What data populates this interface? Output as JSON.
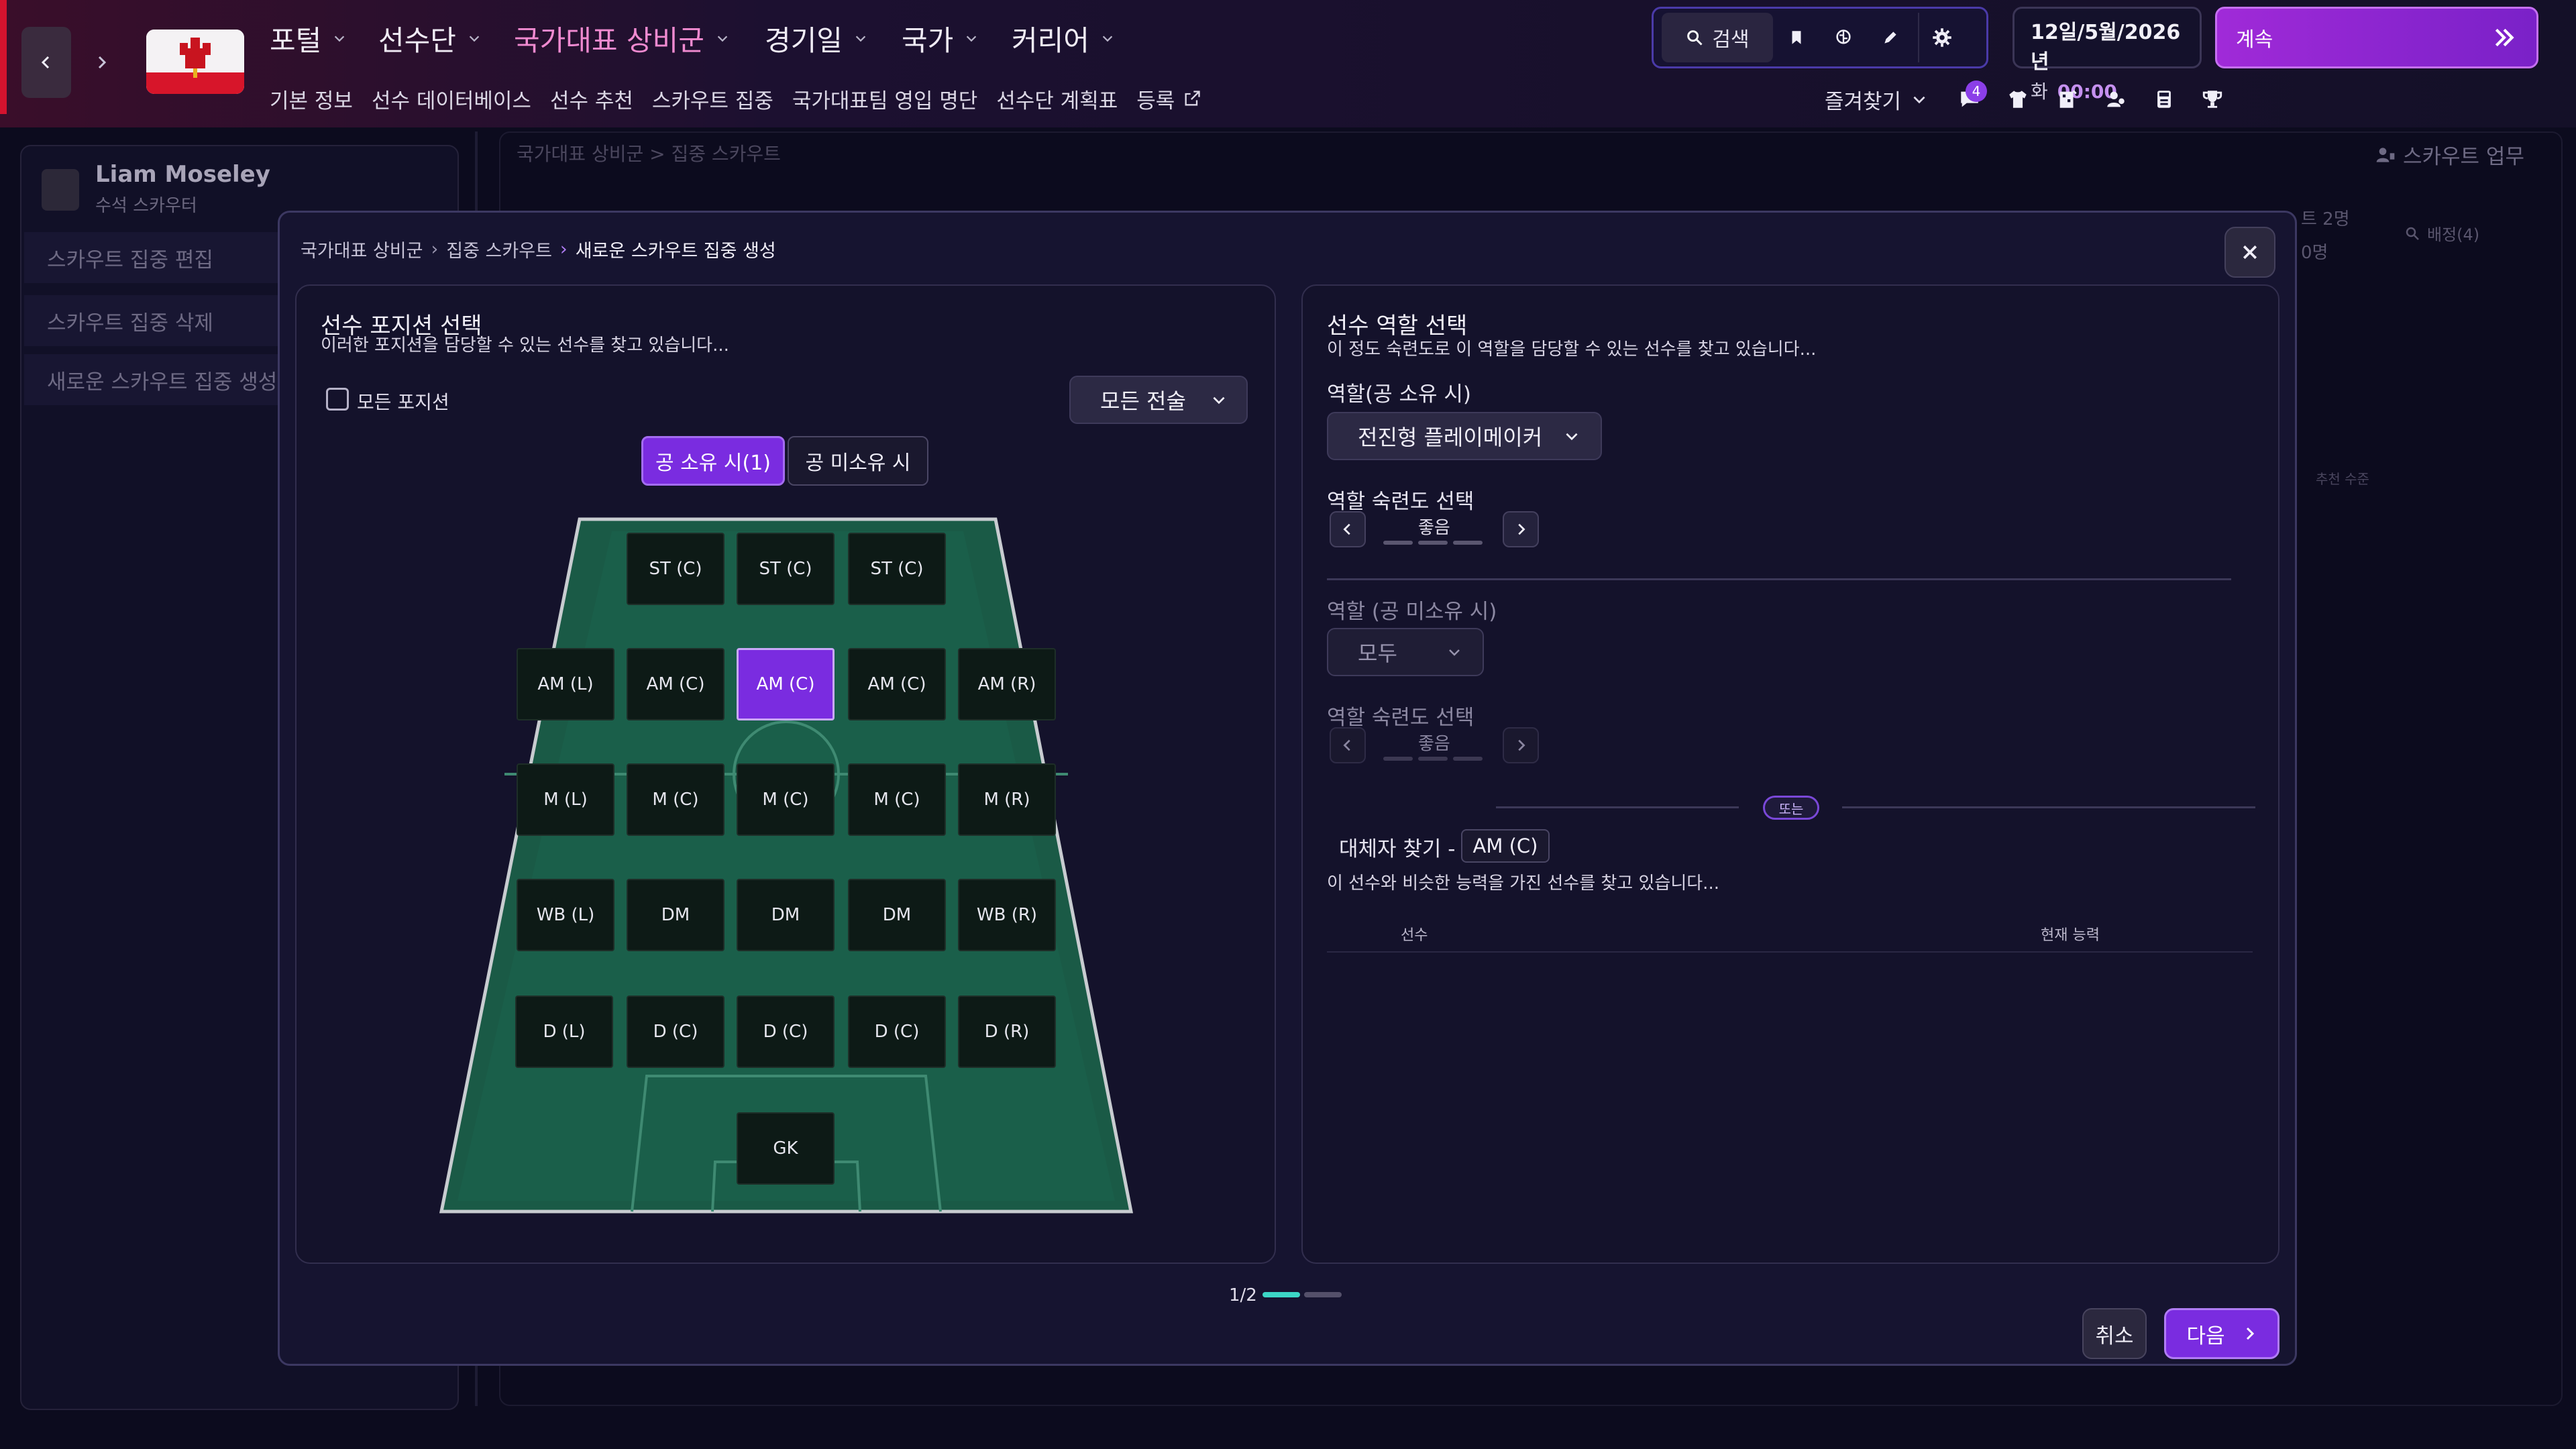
{
  "topbar": {
    "menu": [
      {
        "label": "포털",
        "active": false
      },
      {
        "label": "선수단",
        "active": false
      },
      {
        "label": "국가대표 상비군",
        "active": true
      },
      {
        "label": "경기일",
        "active": false
      },
      {
        "label": "국가",
        "active": false
      },
      {
        "label": "커리어",
        "active": false
      }
    ],
    "submenu": [
      "기본 정보",
      "선수 데이터베이스",
      "선수 추천",
      "스카우트 집중",
      "국가대표팀 영입 명단",
      "선수단 계획표",
      "등록"
    ],
    "search_label": "검색",
    "date_line": "12일/5월/2026년",
    "day": "화",
    "time": "00:00",
    "continue_label": "계속",
    "favorites_label": "즐겨찾기",
    "notification_count": "4",
    "colors": {
      "accent": "#7a2ce0",
      "active_menu": "#f08ad0",
      "continue_bg": "#a02ad8"
    }
  },
  "background": {
    "scout_name": "Liam Moseley",
    "scout_role": "수석 스카우터",
    "left_items": [
      "스카우트 집중 편집",
      "스카우트 집중 삭제",
      "새로운 스카우트 집중 생성"
    ],
    "breadcrumb": "국가대표 상비군 > 집중 스카우트",
    "task_label": "스카우트 업무",
    "partial_texts": [
      "트 2명",
      "0명",
      "배정(4)",
      "추천 수준"
    ]
  },
  "modal": {
    "breadcrumb": [
      "국가대표 상비군",
      "집중 스카우트",
      "새로운 스카우트 집중 생성"
    ],
    "positions_card": {
      "title": "선수 포지션 선택",
      "subtitle": "이러한 포지션을 담당할 수 있는 선수를 찾고 있습니다...",
      "all_positions_label": "모든 포지션",
      "all_positions_checked": false,
      "tactic_label": "모든 전술",
      "toggle_in_possession": "공 소유 시(1)",
      "toggle_out_possession": "공 미소유 시",
      "positions": {
        "st_l": "ST (C)",
        "st_c": "ST (C)",
        "st_r": "ST (C)",
        "aml": "AM (L)",
        "amcl": "AM (C)",
        "amc": "AM (C)",
        "amcr": "AM (C)",
        "amr": "AM (R)",
        "ml": "M (L)",
        "mcl": "M (C)",
        "mc": "M (C)",
        "mcr": "M (C)",
        "mr": "M (R)",
        "wbl": "WB (L)",
        "dmcl": "DM",
        "dmc": "DM",
        "dmcr": "DM",
        "wbr": "WB (R)",
        "dl": "D (L)",
        "dcl": "D (C)",
        "dc": "D (C)",
        "dcr": "D (C)",
        "dr": "D (R)",
        "gk": "GK"
      },
      "selected_position": "AM (C)"
    },
    "roles_card": {
      "title": "선수 역할 선택",
      "subtitle": "이 정도 숙련도로 이 역할을 담당할 수 있는 선수를 찾고 있습니다...",
      "role_in_label": "역할(공 소유 시)",
      "role_in_value": "전진형 플레이메이커",
      "proficiency_in_label": "역할 숙련도 선택",
      "proficiency_in_value": "좋음",
      "role_out_label": "역할 (공 미소유 시)",
      "role_out_value": "모두",
      "proficiency_out_label": "역할 숙련도 선택",
      "proficiency_out_value": "좋음",
      "or_label": "또는",
      "replacement_label": "대체자 찾기 -",
      "replacement_position": "AM (C)",
      "replacement_sub": "이 선수와 비슷한 능력을 가진 선수를 찾고 있습니다...",
      "columns": [
        "선수",
        "현재 능력"
      ]
    },
    "pager": "1/2",
    "cancel_label": "취소",
    "next_label": "다음"
  }
}
